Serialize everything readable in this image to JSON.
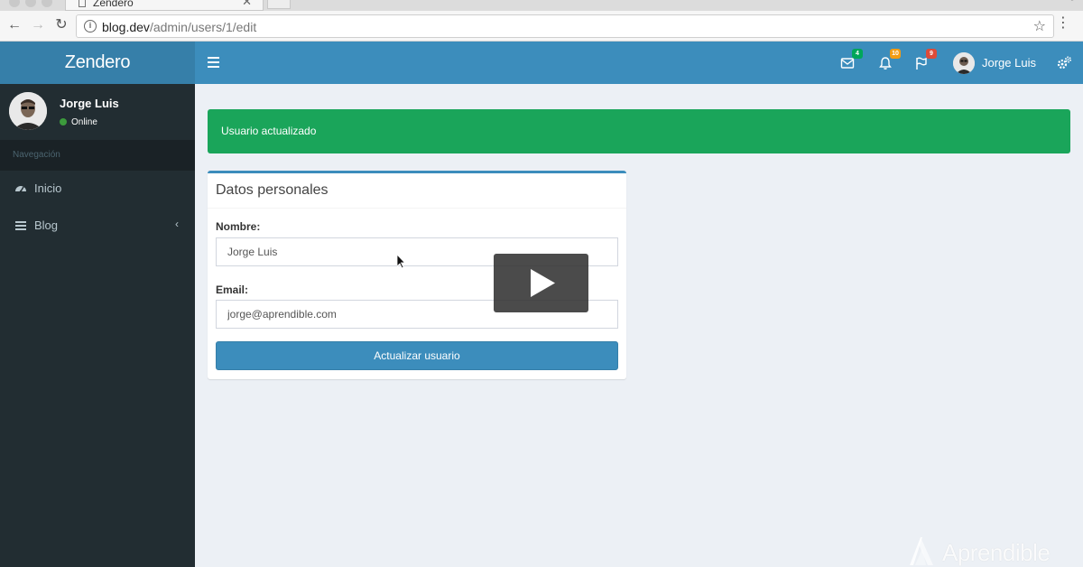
{
  "browser": {
    "tab_title": "Zendero",
    "url_host": "blog.dev",
    "url_path": "/admin/users/1/edit"
  },
  "app": {
    "logo": "Zendero",
    "header": {
      "messages_count": "4",
      "notifications_count": "10",
      "flags_count": "9",
      "user_name": "Jorge Luis"
    },
    "sidebar": {
      "user_name": "Jorge Luis",
      "status": "Online",
      "section_header": "Navegación",
      "items": [
        {
          "label": "Inicio",
          "icon": "dashboard-icon"
        },
        {
          "label": "Blog",
          "icon": "bars-icon"
        }
      ]
    },
    "alert": {
      "message": "Usuario actualizado"
    },
    "form": {
      "title": "Datos personales",
      "name_label": "Nombre:",
      "name_value": "Jorge Luis",
      "email_label": "Email:",
      "email_value": "jorge@aprendible.com",
      "submit_label": "Actualizar usuario"
    },
    "watermark": "Aprendible"
  },
  "colors": {
    "header": "#3c8dbc",
    "logo_bar": "#367fa9",
    "sidebar": "#222d32",
    "alert_success": "#1aa55a",
    "content_bg": "#ecf0f5"
  }
}
